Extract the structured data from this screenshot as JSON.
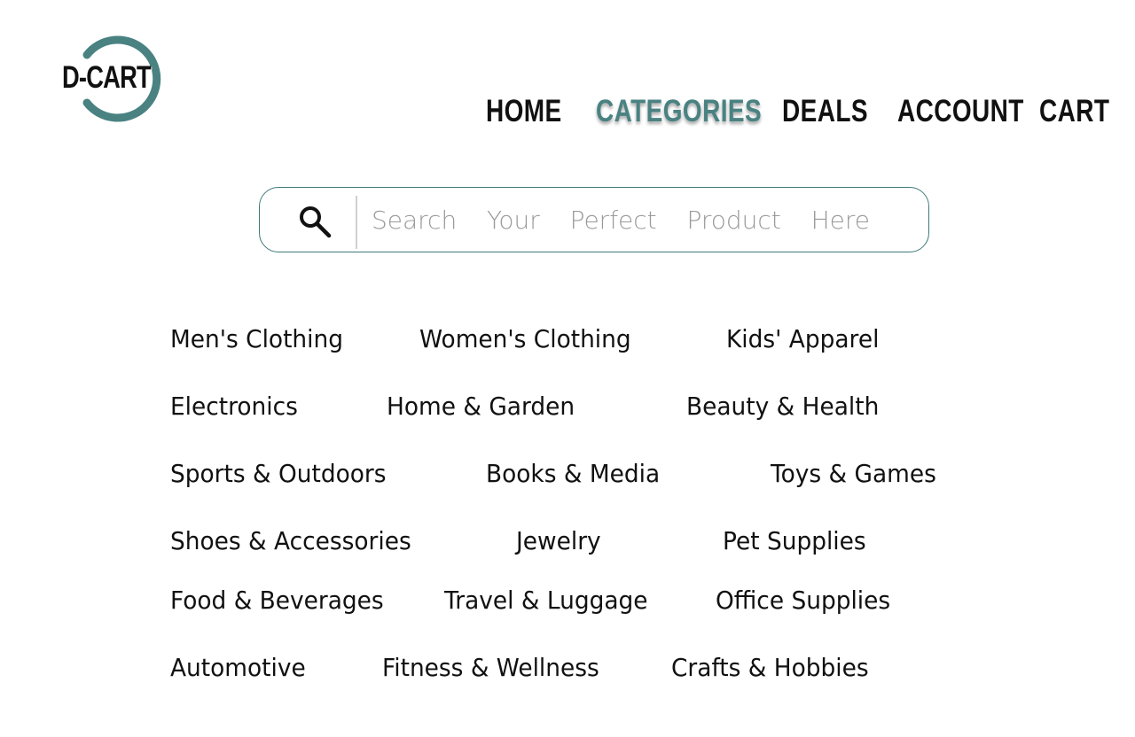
{
  "brand": {
    "logo_text": "D-CART",
    "accent_color": "#4a8282"
  },
  "nav": {
    "items": [
      {
        "label": "HOME",
        "active": false
      },
      {
        "label": "CATEGORIES",
        "active": true
      },
      {
        "label": "DEALS",
        "active": false
      },
      {
        "label": "ACCOUNT",
        "active": false
      },
      {
        "label": "CART",
        "active": false
      }
    ]
  },
  "search": {
    "placeholder": "Search  Your  Perfect  Product  Here",
    "value": "",
    "icon": "search-icon",
    "border_color": "#3f7a79"
  },
  "categories": [
    "Men's Clothing",
    "Women's Clothing",
    "Kids' Apparel",
    "Electronics",
    "Home & Garden",
    "Beauty & Health",
    "Sports & Outdoors",
    "Books & Media",
    "Toys & Games",
    "Shoes & Accessories",
    "Jewelry",
    "Pet Supplies",
    "Food & Beverages",
    "Travel & Luggage",
    "Office Supplies",
    "Automotive",
    "Fitness & Wellness",
    "Crafts & Hobbies"
  ]
}
